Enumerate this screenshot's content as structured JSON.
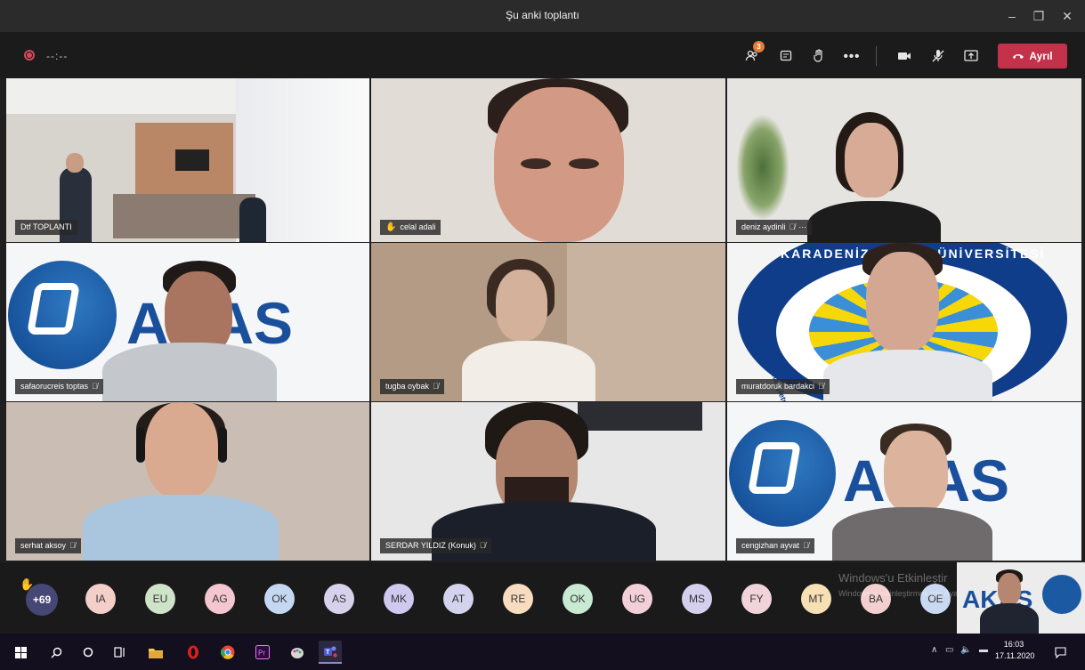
{
  "window": {
    "title": "Şu anki toplantı",
    "minimize": "–",
    "restore": "❐",
    "close": "✕"
  },
  "controls": {
    "timer": "--:--",
    "participants_badge": "3",
    "leave_label": "Ayrıl",
    "accent": "#c4314b"
  },
  "tiles": [
    {
      "name": "Dtf TOPLANTI",
      "muted": false,
      "hand": false
    },
    {
      "name": "celal adali",
      "muted": false,
      "hand": true
    },
    {
      "name": "deniz aydinli",
      "muted": true,
      "hand": false,
      "more": "···"
    },
    {
      "name": "safaorucreis toptas",
      "muted": true,
      "hand": false
    },
    {
      "name": "tugba oybak",
      "muted": true,
      "hand": false
    },
    {
      "name": "muratdoruk bardakci",
      "muted": true,
      "hand": false
    },
    {
      "name": "serhat aksoy",
      "muted": true,
      "hand": false
    },
    {
      "name": "SERDAR YILDIZ (Konuk)",
      "muted": true,
      "hand": false
    },
    {
      "name": "cengizhan ayvat",
      "muted": true,
      "hand": false
    }
  ],
  "logos": {
    "arkas": "AKAS",
    "karadeniz_top": "KARADENİZ TEKNİK ÜNİVERSİTESİ",
    "karadeniz_side": "Deniz Ulaştırma İşletme Mühendisliği"
  },
  "strip": {
    "overflow": "+69",
    "avatars": [
      {
        "initials": "IA",
        "color": "#f3cfc9"
      },
      {
        "initials": "EU",
        "color": "#cfe3c9"
      },
      {
        "initials": "AG",
        "color": "#f4c6cf"
      },
      {
        "initials": "OK",
        "color": "#c5d8f2"
      },
      {
        "initials": "AS",
        "color": "#d8d1ec"
      },
      {
        "initials": "MK",
        "color": "#cfc9ef"
      },
      {
        "initials": "AT",
        "color": "#d3d3ee"
      },
      {
        "initials": "RE",
        "color": "#f8dcc0"
      },
      {
        "initials": "OK",
        "color": "#c8ead2"
      },
      {
        "initials": "UG",
        "color": "#f3cfd8"
      },
      {
        "initials": "MS",
        "color": "#d5cfee"
      },
      {
        "initials": "FY",
        "color": "#f1d3da"
      },
      {
        "initials": "MT",
        "color": "#f7e0b4"
      },
      {
        "initials": "BA",
        "color": "#f3cfcf"
      },
      {
        "initials": "OE",
        "color": "#c9d9f2"
      }
    ],
    "watermark_title": "Windows'u Etkinleştir",
    "watermark_sub": "Windows'u etkinleştirmek için Ayarlar'a gidin."
  },
  "taskbar": {
    "time": "16:03",
    "date": "17.11.2020"
  }
}
